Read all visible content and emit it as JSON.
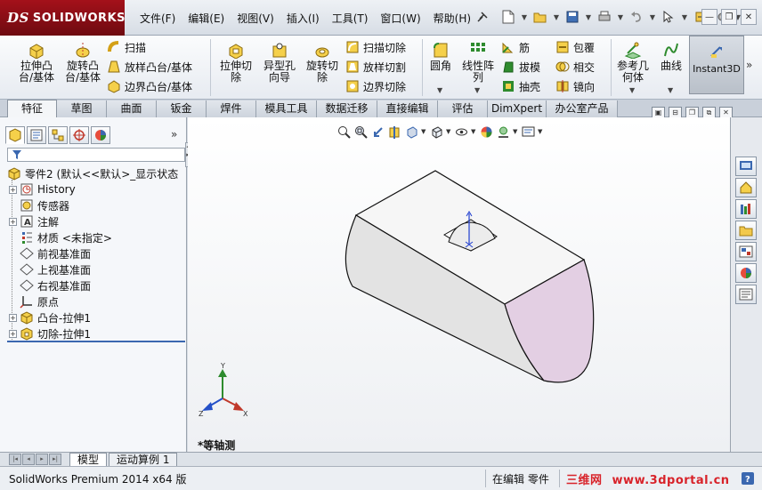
{
  "app": {
    "logo_text": "SOLIDWORKS",
    "brand_prefix": "DS"
  },
  "menu": [
    "文件(F)",
    "编辑(E)",
    "视图(V)",
    "插入(I)",
    "工具(T)",
    "窗口(W)",
    "帮助(H)"
  ],
  "quick_access": [
    "new-icon",
    "open-icon",
    "save-icon",
    "print-icon",
    "undo-icon",
    "select-icon",
    "rebuild-icon",
    "options-icon"
  ],
  "command_manager": {
    "big_buttons": [
      {
        "label": "拉伸凸\n台/基体",
        "icon": "extrude-boss-icon"
      },
      {
        "label": "旋转凸\n台/基体",
        "icon": "revolve-boss-icon"
      },
      {
        "label": "拉伸切\n除",
        "icon": "extrude-cut-icon"
      },
      {
        "label": "异型孔\n向导",
        "icon": "hole-wizard-icon"
      },
      {
        "label": "旋转切\n除",
        "icon": "revolve-cut-icon"
      },
      {
        "label": "圆角",
        "icon": "fillet-icon"
      },
      {
        "label": "线性阵\n列",
        "icon": "linear-pattern-icon"
      },
      {
        "label": "参考几\n何体",
        "icon": "reference-geometry-icon"
      },
      {
        "label": "曲线",
        "icon": "curves-icon"
      }
    ],
    "small_buttons": {
      "sweep": "扫描",
      "loft": "放样凸台/基体",
      "boundary": "边界凸台/基体",
      "swept_cut": "扫描切除",
      "lofted_cut": "放样切割",
      "boundary_cut": "边界切除",
      "rib": "筋",
      "draft": "拔模",
      "shell": "抽壳",
      "wrap": "包覆",
      "intersect": "相交",
      "mirror": "镜向"
    },
    "instant3d": "Instant3D"
  },
  "tabs": [
    {
      "label": "特征",
      "active": true
    },
    {
      "label": "草图",
      "active": false
    },
    {
      "label": "曲面",
      "active": false
    },
    {
      "label": "钣金",
      "active": false
    },
    {
      "label": "焊件",
      "active": false
    },
    {
      "label": "模具工具",
      "active": false
    },
    {
      "label": "数据迁移",
      "active": false
    },
    {
      "label": "直接编辑",
      "active": false
    },
    {
      "label": "评估",
      "active": false
    },
    {
      "label": "DimXpert",
      "active": false
    },
    {
      "label": "办公室产品",
      "active": false
    }
  ],
  "feature_tree": {
    "root": "零件2 (默认<<默认>_显示状态",
    "items": [
      {
        "label": "History",
        "icon": "history-icon",
        "expandable": true
      },
      {
        "label": "传感器",
        "icon": "sensor-icon",
        "expandable": false
      },
      {
        "label": "注解",
        "icon": "annotation-icon",
        "expandable": true
      },
      {
        "label": "材质 <未指定>",
        "icon": "material-icon",
        "expandable": false
      },
      {
        "label": "前视基准面",
        "icon": "plane-icon",
        "expandable": false
      },
      {
        "label": "上视基准面",
        "icon": "plane-icon",
        "expandable": false
      },
      {
        "label": "右视基准面",
        "icon": "plane-icon",
        "expandable": false
      },
      {
        "label": "原点",
        "icon": "origin-icon",
        "expandable": false
      },
      {
        "label": "凸台-拉伸1",
        "icon": "extrude-boss-icon",
        "expandable": true
      },
      {
        "label": "切除-拉伸1",
        "icon": "extrude-cut-icon",
        "expandable": true
      }
    ]
  },
  "viewport": {
    "view_label": "*等轴测",
    "triad": {
      "x": "X",
      "y": "Y",
      "z": "Z"
    }
  },
  "bottom_tabs": [
    {
      "label": "模型",
      "active": true
    },
    {
      "label": "运动算例 1",
      "active": false
    }
  ],
  "status": {
    "version": "SolidWorks Premium 2014 x64 版",
    "mode": "在编辑 零件",
    "watermark_cn": "三维网",
    "watermark_url": "www.3dportal.cn"
  },
  "colors": {
    "brand_red": "#a4111a",
    "part_gray": "#dcdcdc",
    "face_highlight": "#e3cfe3",
    "active_tab_blue": "#3b68b0"
  }
}
